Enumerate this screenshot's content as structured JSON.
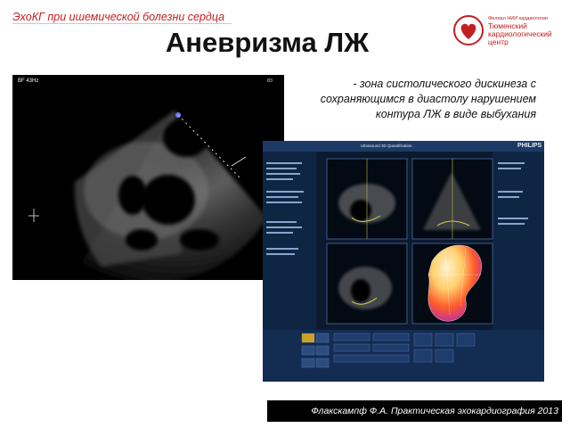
{
  "header": {
    "subtitle": "ЭхоКГ при ишемической болезни сердца",
    "title": "Аневризма ЛЖ"
  },
  "logo": {
    "small_text": "Филиал НИИ кардиологии",
    "name_text": "Тюменский кардиологический центр"
  },
  "description": {
    "text": "- зона систолического дискинеза с сохраняющимся в диастолу нарушением контура ЛЖ в виде выбухания"
  },
  "echo_image": {
    "label_top": "BF 43Hz",
    "label_right": "83"
  },
  "qlab_image": {
    "brand": "PHILIPS",
    "window_title": "Ultrasound 3D Quantification"
  },
  "footer": {
    "citation": "Флакскампф Ф.А. Практическая эхокардиография 2013"
  },
  "colors": {
    "accent_red": "#c0201f",
    "footer_bg": "#000000",
    "qlab_bg": "#0b1a2f"
  }
}
